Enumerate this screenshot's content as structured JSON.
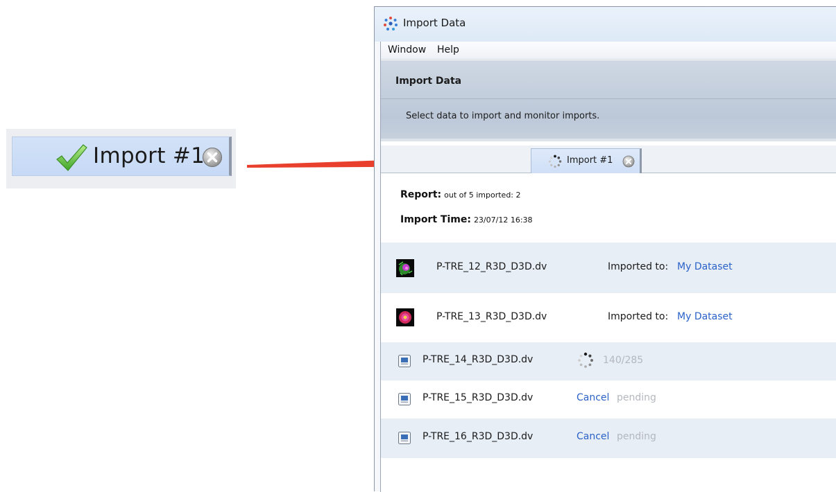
{
  "callout": {
    "tab_label": "Import #1",
    "status": "complete"
  },
  "window": {
    "title": "Import Data",
    "menu": [
      "Window",
      "Help"
    ]
  },
  "banner": {
    "title": "Import Data",
    "description": "Select data to import and monitor imports."
  },
  "tabs": [
    {
      "label": "Import #1",
      "status": "in-progress"
    }
  ],
  "report": {
    "report_label": "Report:",
    "report_value": "out of 5 imported: 2",
    "time_label": "Import Time:",
    "time_value": "23/07/12 16:38"
  },
  "files": [
    {
      "name": "P-TRE_12_R3D_D3D.dv",
      "status": "imported",
      "imported_label": "Imported to:",
      "dataset": "My Dataset"
    },
    {
      "name": "P-TRE_13_R3D_D3D.dv",
      "status": "imported",
      "imported_label": "Imported to:",
      "dataset": "My Dataset"
    },
    {
      "name": "P-TRE_14_R3D_D3D.dv",
      "status": "importing",
      "progress_text": "140/285",
      "progress": 0.491
    },
    {
      "name": "P-TRE_15_R3D_D3D.dv",
      "status": "pending",
      "cancel_label": "Cancel",
      "pending_label": "pending"
    },
    {
      "name": "P-TRE_16_R3D_D3D.dv",
      "status": "pending",
      "cancel_label": "Cancel",
      "pending_label": "pending"
    }
  ],
  "colors": {
    "link": "#2a62c8",
    "arrow": "#e8402c",
    "muted": "#b4b8be"
  }
}
